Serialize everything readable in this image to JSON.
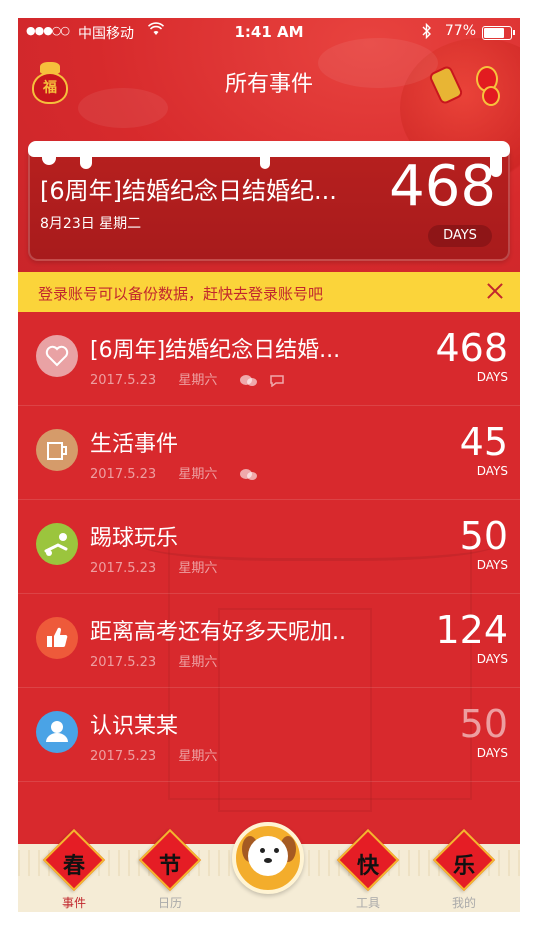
{
  "status_bar": {
    "signal": "●●●○○",
    "carrier": "中国移动",
    "time": "1:41 AM",
    "battery": "77%"
  },
  "nav": {
    "title": "所有事件",
    "bag_char": "福"
  },
  "featured": {
    "title": "[6周年]结婚纪念日结婚纪...",
    "date": "8月23日  星期二",
    "count": "468",
    "unit": "DAYS"
  },
  "banner": {
    "text": "登录账号可以备份数据，赶快去登录账号吧"
  },
  "events": [
    {
      "title": "[6周年]结婚纪念日结婚...",
      "date": "2017.5.23",
      "weekday": "星期六",
      "count": "468",
      "unit": "DAYS",
      "icon": "heart-icon",
      "color": "#e9a2a4",
      "meta_icons": [
        "wechat-icon",
        "comment-icon"
      ]
    },
    {
      "title": "生活事件",
      "date": "2017.5.23",
      "weekday": "星期六",
      "count": "45",
      "unit": "DAYS",
      "icon": "cup-icon",
      "color": "#d59b6a",
      "meta_icons": [
        "wechat-icon"
      ]
    },
    {
      "title": "踢球玩乐",
      "date": "2017.5.23",
      "weekday": "星期六",
      "count": "50",
      "unit": "DAYS",
      "icon": "soccer-icon",
      "color": "#9bc53d",
      "meta_icons": []
    },
    {
      "title": "距离高考还有好多天呢加..",
      "date": "2017.5.23",
      "weekday": "星期六",
      "count": "124",
      "unit": "DAYS",
      "icon": "thumbs-up-icon",
      "color": "#ee5a3a",
      "meta_icons": []
    },
    {
      "title": "认识某某",
      "date": "2017.5.23",
      "weekday": "星期六",
      "count": "50",
      "unit": "DAYS",
      "icon": "person-icon",
      "color": "#4aa3e6",
      "meta_icons": []
    }
  ],
  "tabbar": {
    "tabs": [
      {
        "char": "春",
        "label": "事件",
        "active": true
      },
      {
        "char": "节",
        "label": "日历",
        "active": false
      },
      {
        "char": "快",
        "label": "工具",
        "active": false
      },
      {
        "char": "乐",
        "label": "我的",
        "active": false
      }
    ]
  },
  "colors": {
    "background": "#d8292d",
    "banner": "#fbd43a",
    "banner_text": "#c1272d",
    "tab_active": "#c1272d"
  }
}
